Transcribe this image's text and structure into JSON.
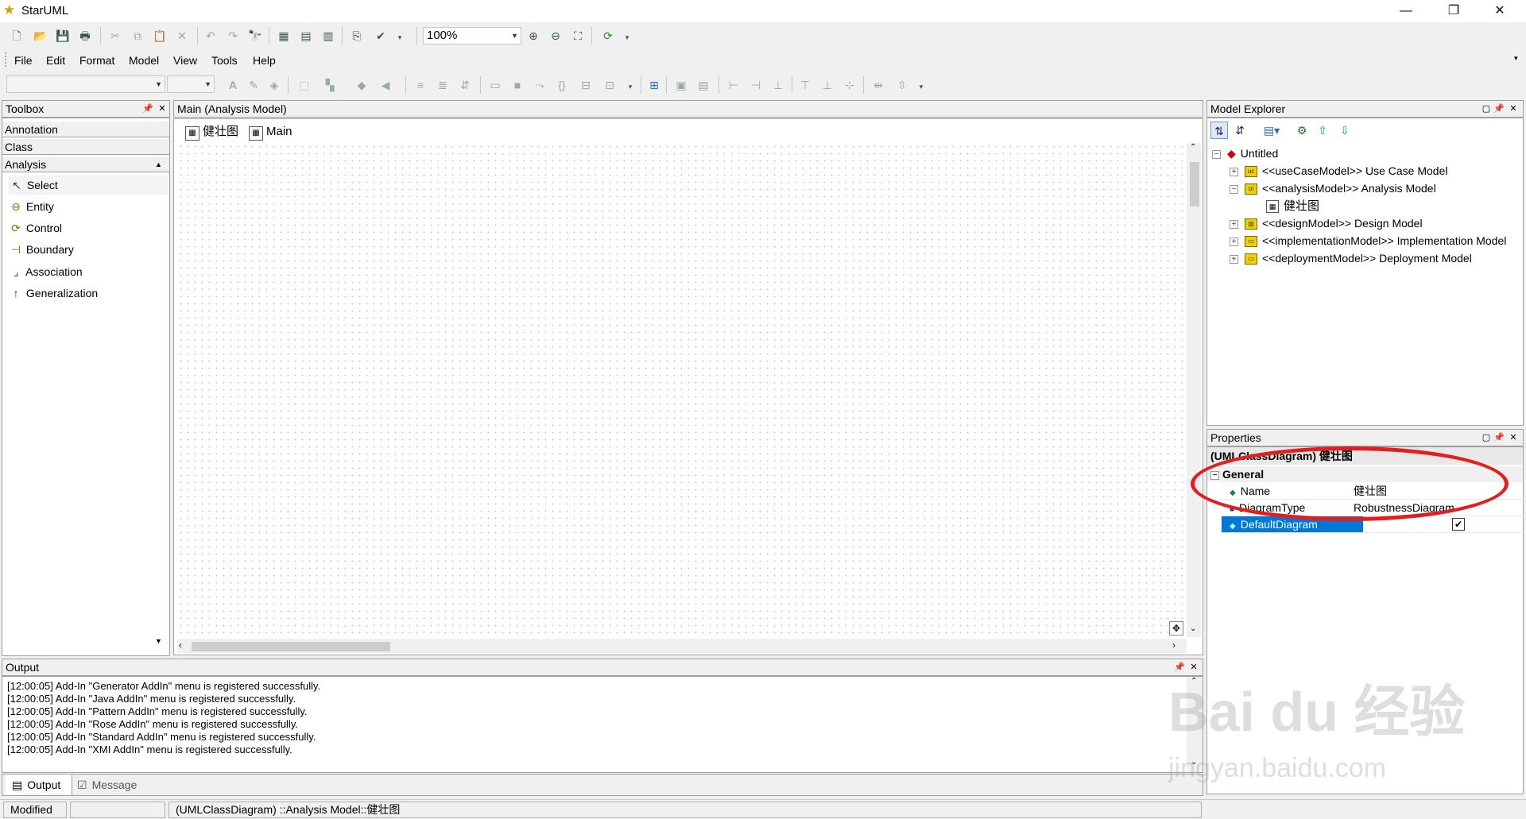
{
  "app": {
    "title": "StarUML",
    "icon": "star-icon"
  },
  "toolbar1": {
    "zoom": "100%"
  },
  "menu": {
    "items": [
      "File",
      "Edit",
      "Format",
      "Model",
      "View",
      "Tools",
      "Help"
    ]
  },
  "toolbox": {
    "title": "Toolbox",
    "categories": [
      "Annotation",
      "Class",
      "Analysis"
    ],
    "items": [
      "Select",
      "Entity",
      "Control",
      "Boundary",
      "Association",
      "Generalization"
    ]
  },
  "diagram": {
    "header": "Main (Analysis Model)",
    "tabs": [
      "健壮图",
      "Main"
    ]
  },
  "explorer": {
    "title": "Model Explorer",
    "root": "Untitled",
    "nodes": [
      "<<useCaseModel>> Use Case Model",
      "<<analysisModel>> Analysis Model",
      "健壮图",
      "<<designModel>> Design Model",
      "<<implementationModel>> Implementation Model",
      "<<deploymentModel>> Deployment Model"
    ]
  },
  "properties": {
    "title": "Properties",
    "selected": "(UMLClassDiagram) 健壮图",
    "group": "General",
    "rows": [
      {
        "name": "Name",
        "value": "健壮图"
      },
      {
        "name": "DiagramType",
        "value": "RobustnessDiagram"
      },
      {
        "name": "DefaultDiagram",
        "value": "✔"
      }
    ]
  },
  "output": {
    "title": "Output",
    "lines": [
      "[12:00:05]  Add-In \"Generator AddIn\" menu is registered successfully.",
      "[12:00:05]  Add-In \"Java AddIn\" menu is registered successfully.",
      "[12:00:05]  Add-In \"Pattern AddIn\" menu is registered successfully.",
      "[12:00:05]  Add-In \"Rose AddIn\" menu is registered successfully.",
      "[12:00:05]  Add-In \"Standard AddIn\" menu is registered successfully.",
      "[12:00:05]  Add-In \"XMI AddIn\" menu is registered successfully."
    ],
    "tabs": [
      "Output",
      "Message"
    ]
  },
  "status": {
    "state": "Modified",
    "empty": "",
    "path": "(UMLClassDiagram) ::Analysis Model::健壮图"
  },
  "watermark": {
    "line1": "Bai du 经验",
    "line2": "jingyan.baidu.com"
  },
  "colors": {
    "selection": "#0078d7",
    "annotation": "#e02020",
    "package": "#f0d000"
  }
}
